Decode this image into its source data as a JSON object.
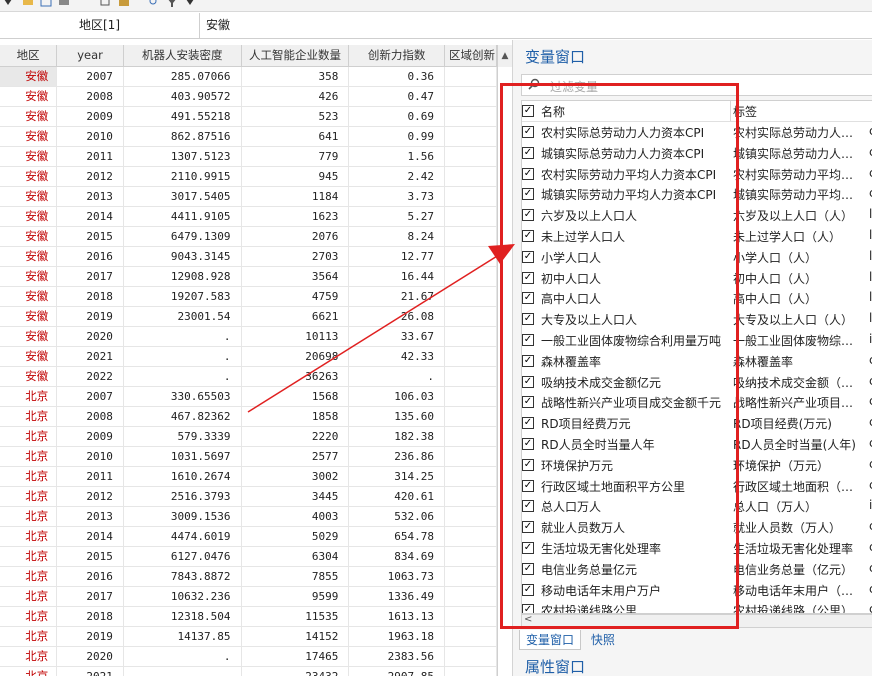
{
  "edit_bar": {
    "cell_name": "地区[1]",
    "cell_value": "安徽"
  },
  "grid": {
    "columns": [
      "地区",
      "year",
      "机器人安装密度",
      "人工智能企业数量",
      "创新力指数",
      "区域创新"
    ],
    "rows": [
      [
        "安徽",
        "2007",
        "285.07066",
        "358",
        "0.36"
      ],
      [
        "安徽",
        "2008",
        "403.90572",
        "426",
        "0.47"
      ],
      [
        "安徽",
        "2009",
        "491.55218",
        "523",
        "0.69"
      ],
      [
        "安徽",
        "2010",
        "862.87516",
        "641",
        "0.99"
      ],
      [
        "安徽",
        "2011",
        "1307.5123",
        "779",
        "1.56"
      ],
      [
        "安徽",
        "2012",
        "2110.9915",
        "945",
        "2.42"
      ],
      [
        "安徽",
        "2013",
        "3017.5405",
        "1184",
        "3.73"
      ],
      [
        "安徽",
        "2014",
        "4411.9105",
        "1623",
        "5.27"
      ],
      [
        "安徽",
        "2015",
        "6479.1309",
        "2076",
        "8.24"
      ],
      [
        "安徽",
        "2016",
        "9043.3145",
        "2703",
        "12.77"
      ],
      [
        "安徽",
        "2017",
        "12908.928",
        "3564",
        "16.44"
      ],
      [
        "安徽",
        "2018",
        "19207.583",
        "4759",
        "21.67"
      ],
      [
        "安徽",
        "2019",
        "23001.54",
        "6621",
        "26.08"
      ],
      [
        "安徽",
        "2020",
        ".",
        "10113",
        "33.67"
      ],
      [
        "安徽",
        "2021",
        ".",
        "20698",
        "42.33"
      ],
      [
        "安徽",
        "2022",
        ".",
        "36263",
        "."
      ],
      [
        "北京",
        "2007",
        "330.65503",
        "1568",
        "106.03"
      ],
      [
        "北京",
        "2008",
        "467.82362",
        "1858",
        "135.60"
      ],
      [
        "北京",
        "2009",
        "579.3339",
        "2220",
        "182.38"
      ],
      [
        "北京",
        "2010",
        "1031.5697",
        "2577",
        "236.86"
      ],
      [
        "北京",
        "2011",
        "1610.2674",
        "3002",
        "314.25"
      ],
      [
        "北京",
        "2012",
        "2516.3793",
        "3445",
        "420.61"
      ],
      [
        "北京",
        "2013",
        "3009.1536",
        "4003",
        "532.06"
      ],
      [
        "北京",
        "2014",
        "4474.6019",
        "5029",
        "654.78"
      ],
      [
        "北京",
        "2015",
        "6127.0476",
        "6304",
        "834.69"
      ],
      [
        "北京",
        "2016",
        "7843.8872",
        "7855",
        "1063.73"
      ],
      [
        "北京",
        "2017",
        "10632.236",
        "9599",
        "1336.49"
      ],
      [
        "北京",
        "2018",
        "12318.504",
        "11535",
        "1613.13"
      ],
      [
        "北京",
        "2019",
        "14137.85",
        "14152",
        "1963.18"
      ],
      [
        "北京",
        "2020",
        ".",
        "17465",
        "2383.56"
      ],
      [
        "北京",
        "2021",
        ".",
        "23432",
        "2907.85"
      ]
    ]
  },
  "variables_panel": {
    "title": "变量窗口",
    "filter_placeholder": "过滤变量",
    "header": {
      "name": "名称",
      "label": "标签"
    },
    "items": [
      {
        "name": "农村实际总劳动力人力资本CPI",
        "label": "农村实际总劳动力人力...",
        "type": "c"
      },
      {
        "name": "城镇实际总劳动力人力资本CPI",
        "label": "城镇实际总劳动力人力...",
        "type": "c"
      },
      {
        "name": "农村实际劳动力平均人力资本CPI",
        "label": "农村实际劳动力平均人...",
        "type": "c"
      },
      {
        "name": "城镇实际劳动力平均人力资本CPI",
        "label": "城镇实际劳动力平均人...",
        "type": "c"
      },
      {
        "name": "六岁及以上人口人",
        "label": "六岁及以上人口（人）",
        "type": "l"
      },
      {
        "name": "未上过学人口人",
        "label": "未上过学人口（人）",
        "type": "l"
      },
      {
        "name": "小学人口人",
        "label": "小学人口（人）",
        "type": "l"
      },
      {
        "name": "初中人口人",
        "label": "初中人口（人）",
        "type": "l"
      },
      {
        "name": "高中人口人",
        "label": "高中人口（人）",
        "type": "l"
      },
      {
        "name": "大专及以上人口人",
        "label": "大专及以上人口（人）",
        "type": "l"
      },
      {
        "name": "一般工业固体废物综合利用量万吨",
        "label": "一般工业固体废物综合...",
        "type": "i"
      },
      {
        "name": "森林覆盖率",
        "label": "森林覆盖率",
        "type": "c"
      },
      {
        "name": "吸纳技术成交金额亿元",
        "label": "吸纳技术成交金额（亿...",
        "type": "c"
      },
      {
        "name": "战略性新兴产业项目成交金额千元",
        "label": "战略性新兴产业项目成...",
        "type": "c"
      },
      {
        "name": "RD项目经费万元",
        "label": "RD项目经费(万元)",
        "type": "c"
      },
      {
        "name": "RD人员全时当量人年",
        "label": "RD人员全时当量(人年)",
        "type": "c"
      },
      {
        "name": "环境保护万元",
        "label": "环境保护（万元）",
        "type": "c"
      },
      {
        "name": "行政区域土地面积平方公里",
        "label": "行政区域土地面积（平...",
        "type": "c"
      },
      {
        "name": "总人口万人",
        "label": "总人口（万人）",
        "type": "i"
      },
      {
        "name": "就业人员数万人",
        "label": "就业人员数（万人）",
        "type": "c"
      },
      {
        "name": "生活垃圾无害化处理率",
        "label": "生活垃圾无害化处理率",
        "type": "c"
      },
      {
        "name": "电信业务总量亿元",
        "label": "电信业务总量（亿元）",
        "type": "c"
      },
      {
        "name": "移动电话年末用户万户",
        "label": "移动电话年末用户（万...",
        "type": "c"
      },
      {
        "name": "农村投递线路公里",
        "label": "农村投递线路（公里）",
        "type": "c"
      }
    ],
    "tabs": [
      "变量窗口",
      "快照"
    ],
    "properties_title": "属性窗口"
  },
  "colors": {
    "accent": "#1f5fa8",
    "region_text": "#c00000",
    "annotation": "#e02020"
  },
  "icons": [
    "search-icon",
    "checkbox-icon",
    "scroll-up-icon",
    "scroll-left-icon"
  ]
}
